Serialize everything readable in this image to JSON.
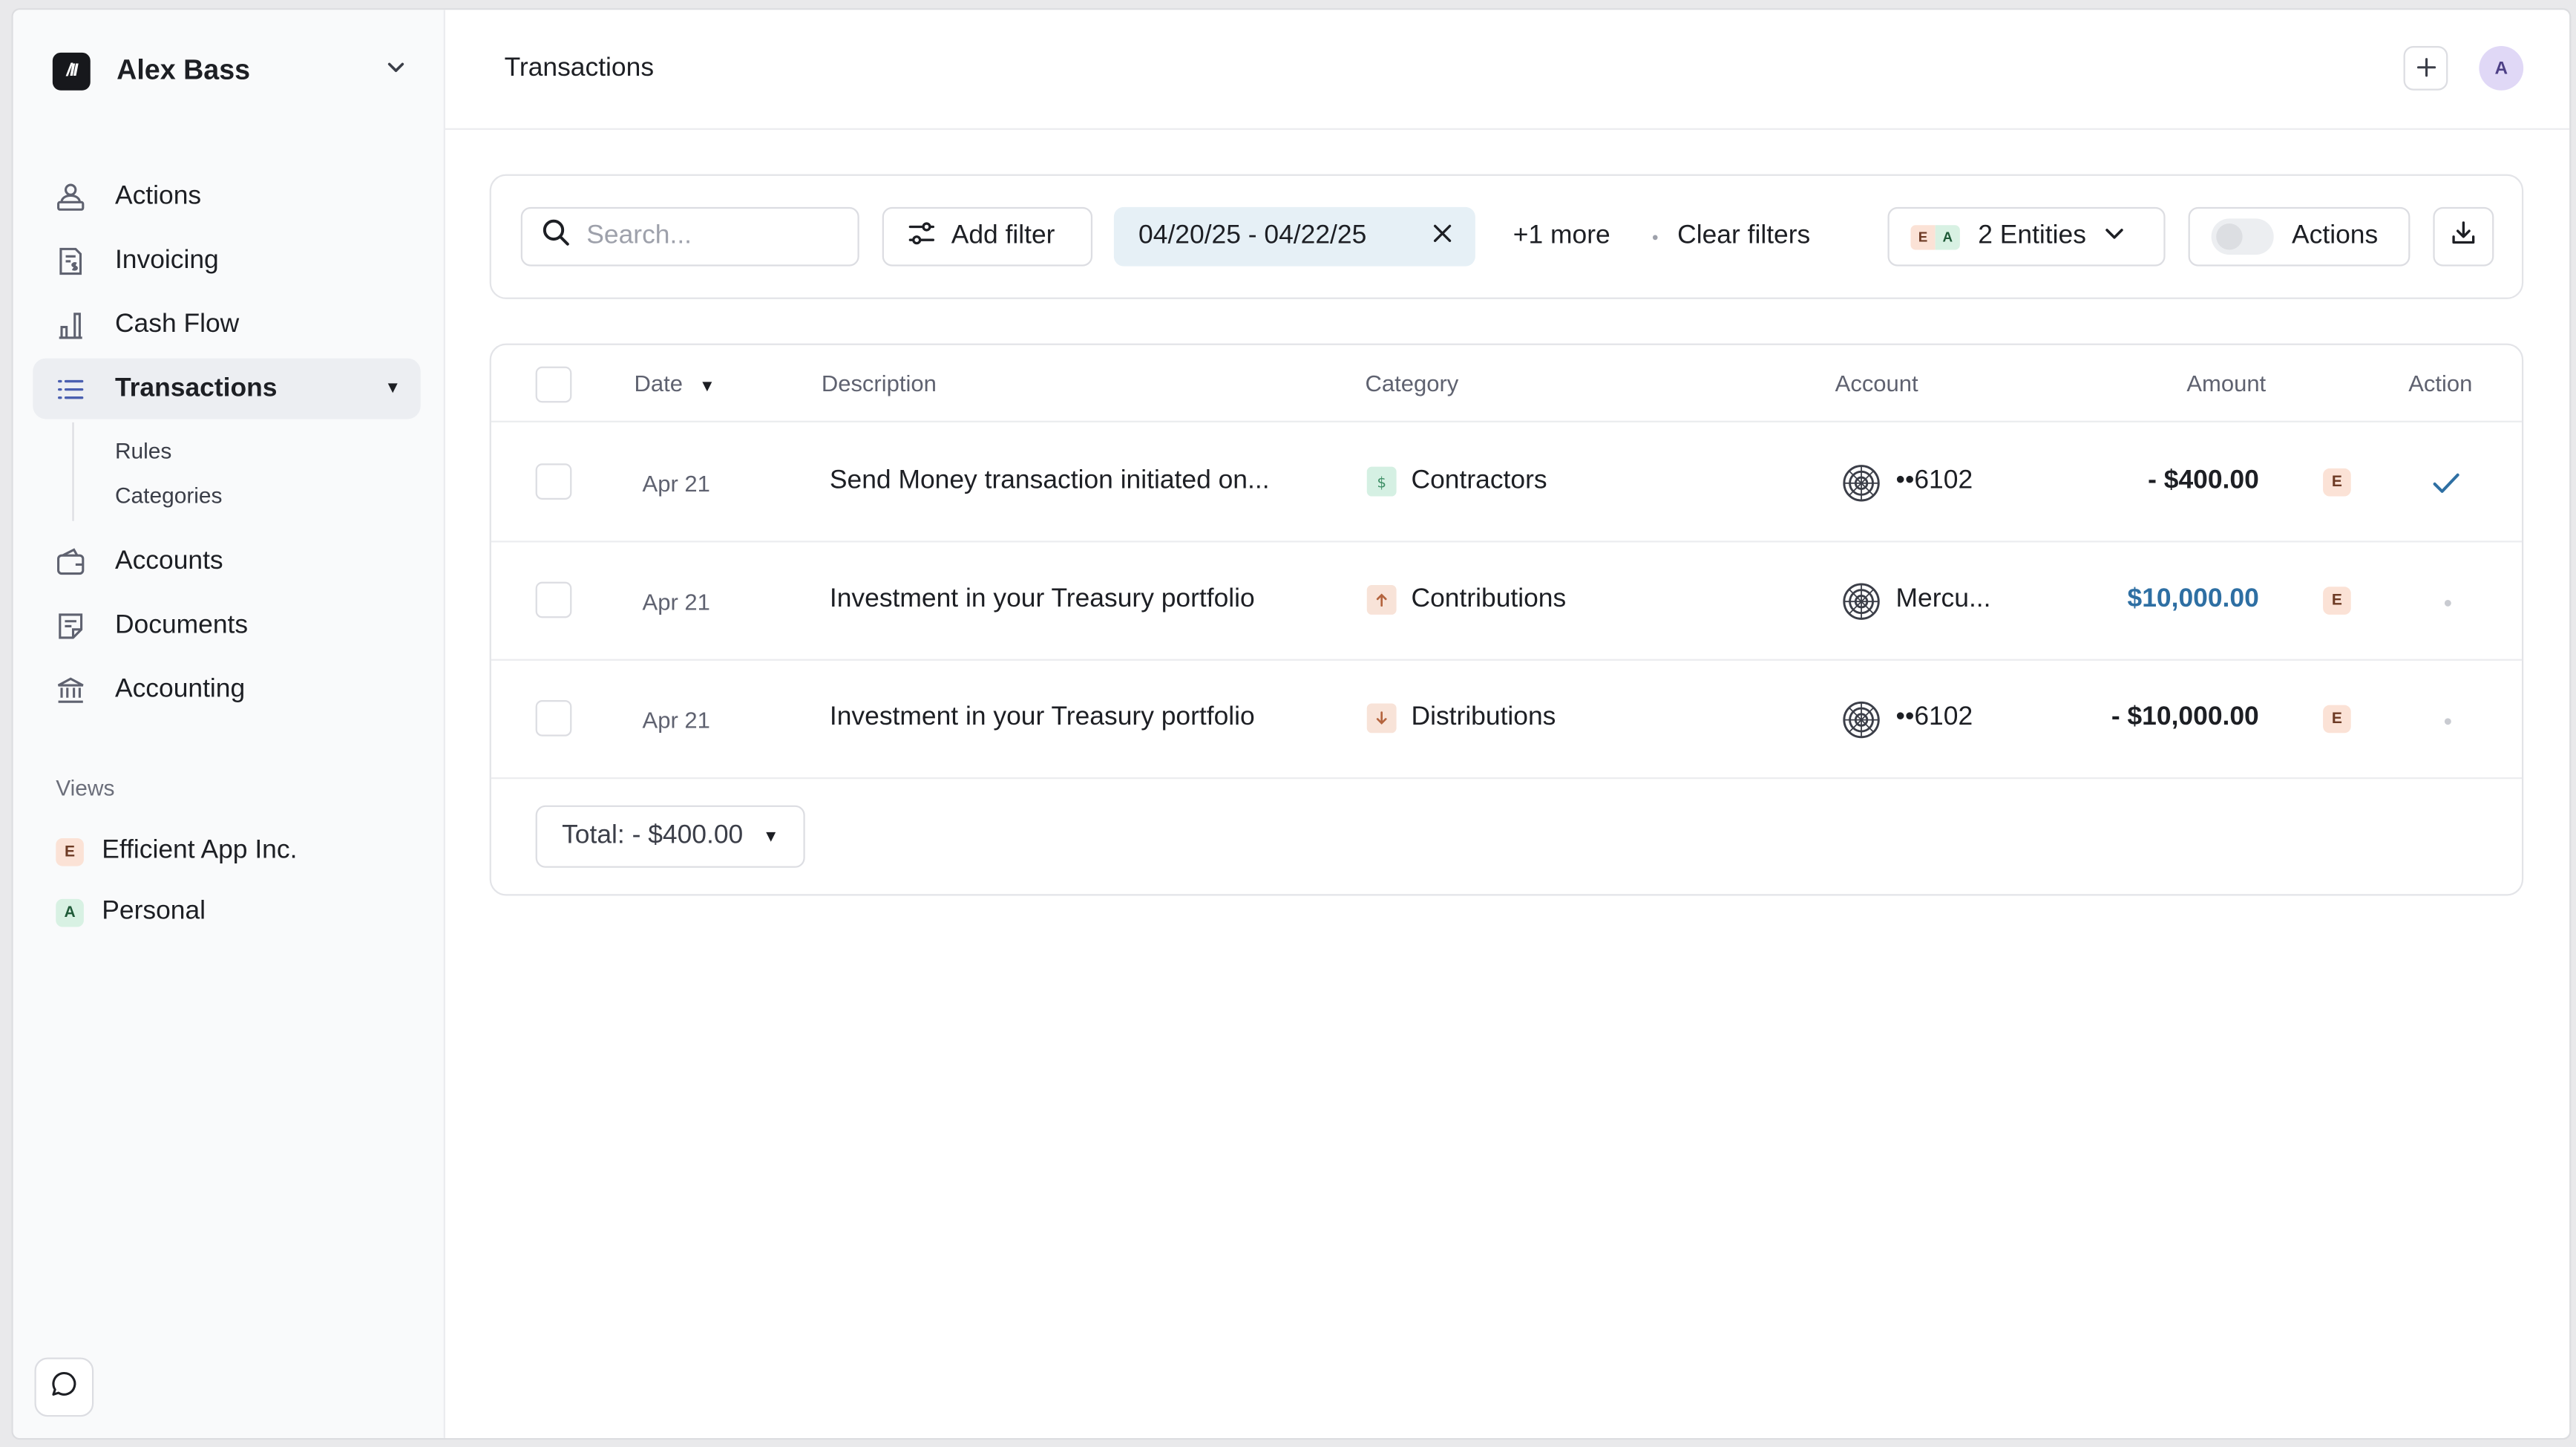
{
  "org": {
    "logo_text": "/II",
    "name": "Alex Bass"
  },
  "nav": {
    "items": [
      {
        "label": "Actions",
        "icon": "user-stack-icon"
      },
      {
        "label": "Invoicing",
        "icon": "invoice-icon"
      },
      {
        "label": "Cash Flow",
        "icon": "bar-chart-icon"
      },
      {
        "label": "Transactions",
        "icon": "list-icon",
        "active": true
      },
      {
        "label": "Accounts",
        "icon": "wallet-icon"
      },
      {
        "label": "Documents",
        "icon": "document-icon"
      },
      {
        "label": "Accounting",
        "icon": "bank-icon"
      }
    ],
    "subitems": [
      "Rules",
      "Categories"
    ]
  },
  "views": {
    "heading": "Views",
    "items": [
      {
        "badge": "E",
        "label": "Efficient App Inc."
      },
      {
        "badge": "A",
        "label": "Personal"
      }
    ]
  },
  "header": {
    "title": "Transactions",
    "avatar": "A"
  },
  "filters": {
    "search_placeholder": "Search...",
    "add_filter": "Add filter",
    "date_range": "04/20/25 - 04/22/25",
    "more": "+1 more",
    "clear": "Clear filters",
    "entity_badges": [
      "E",
      "A"
    ],
    "entities": "2 Entities",
    "actions": "Actions"
  },
  "table": {
    "columns": [
      "Date",
      "Description",
      "Category",
      "Account",
      "Amount",
      "Action"
    ],
    "rows": [
      {
        "date": "Apr 21",
        "description": "Send Money transaction initiated on...",
        "category": "Contractors",
        "category_icon": "dollar-icon",
        "account": "••6102",
        "amount": "- $400.00",
        "entity": "E",
        "action": "check"
      },
      {
        "date": "Apr 21",
        "description": "Investment in your Treasury portfolio",
        "category": "Contributions",
        "category_icon": "arrow-up-icon",
        "account": "Mercu...",
        "amount": "$10,000.00",
        "entity": "E",
        "action": "none"
      },
      {
        "date": "Apr 21",
        "description": "Investment in your Treasury portfolio",
        "category": "Distributions",
        "category_icon": "arrow-down-icon",
        "account": "••6102",
        "amount": "- $10,000.00",
        "entity": "E",
        "action": "none"
      }
    ],
    "total": "Total: - $400.00"
  },
  "colors": {
    "positive_amount": "#2e6fa3",
    "active_chip": "#e6f0f6",
    "entity_e": "#fbe2d6",
    "entity_a": "#d8f1e3"
  }
}
